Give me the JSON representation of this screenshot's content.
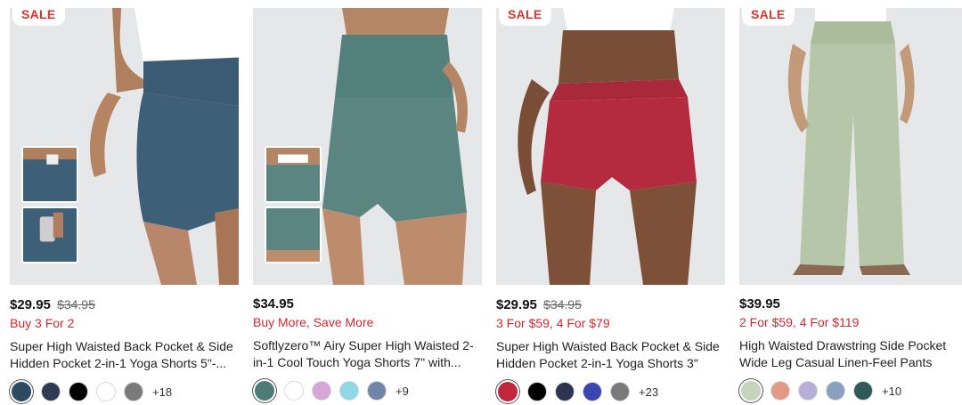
{
  "products": [
    {
      "badge": "SALE",
      "price": "$29.95",
      "old_price": "$34.95",
      "promo": "Buy 3 For 2",
      "title": "Super High Waisted Back Pocket & Side Hidden Pocket 2-in-1 Yoga Shorts 5\"-...",
      "product_color": "#3e5f78",
      "swatches": [
        "#2e4a63",
        "#2f3b55",
        "#000000",
        "#ffffff",
        "#7a7a7a"
      ],
      "more": "+18"
    },
    {
      "badge": "",
      "price": "$34.95",
      "old_price": "",
      "promo": "Buy More, Save More",
      "title": "Softlyzero™ Airy Super High Waisted 2-in-1 Cool Touch Yoga Shorts 7\" with...",
      "product_color": "#5b8581",
      "swatches": [
        "#4f7b76",
        "#ffffff",
        "#d7a6d9",
        "#8fd8e6",
        "#7185a8"
      ],
      "more": "+9"
    },
    {
      "badge": "SALE",
      "price": "$29.95",
      "old_price": "$34.95",
      "promo": "3 For $59, 4 For $79",
      "title": "Super High Waisted Back Pocket & Side Hidden Pocket 2-in-1 Yoga Shorts 3\"",
      "product_color": "#b42a3e",
      "swatches": [
        "#c2263f",
        "#000000",
        "#2c3550",
        "#3b47b0",
        "#7a7a7a"
      ],
      "more": "+23"
    },
    {
      "badge": "SALE",
      "price": "$39.95",
      "old_price": "",
      "promo": "2 For $59, 4 For $119",
      "title": "High Waisted Drawstring Side Pocket Wide Leg Casual Linen-Feel Pants",
      "product_color": "#b5c7a8",
      "swatches": [
        "#c4d4bd",
        "#e19a83",
        "#b8b0d4",
        "#8aa0bf",
        "#2f5a57"
      ],
      "more": "+10"
    }
  ]
}
